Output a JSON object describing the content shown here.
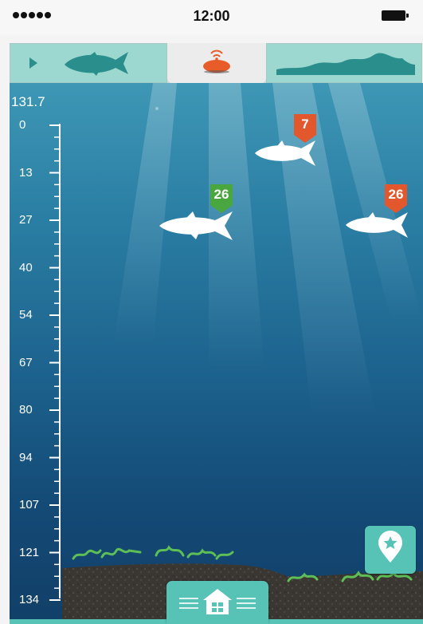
{
  "status_bar": {
    "time": "12:00"
  },
  "depth_scale": {
    "max_depth_readout": "131.7",
    "labels": [
      "0",
      "13",
      "27",
      "40",
      "54",
      "67",
      "80",
      "94",
      "107",
      "121",
      "134"
    ]
  },
  "fish_markers": [
    {
      "value": "7",
      "color": "#e2572c"
    },
    {
      "value": "26",
      "color": "#4aa63f"
    },
    {
      "value": "26",
      "color": "#e2572c"
    }
  ],
  "colors": {
    "accent": "#57c2b6",
    "sonar_orange": "#e85c2a",
    "marker_green": "#4aa63f",
    "marker_orange": "#e2572c",
    "seaweed": "#5dbf55"
  },
  "icons": {
    "play": "play-icon",
    "fish": "fish-icon",
    "sonar": "sonar-device-icon",
    "terrain": "terrain-icon",
    "pin": "location-pin-star-icon",
    "home": "home-icon"
  }
}
